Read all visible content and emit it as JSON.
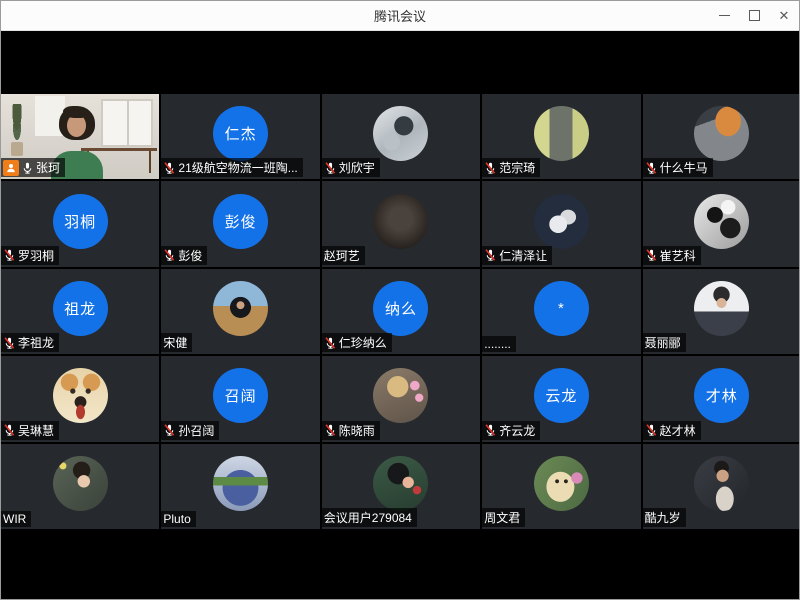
{
  "window": {
    "title": "腾讯会议",
    "controls": [
      "minimize",
      "maximize",
      "close"
    ]
  },
  "colors": {
    "accent_blue": "#1472E8",
    "tile_background": "#26292E",
    "content_background": "#000000",
    "titlebar_background": "#FCFCFC",
    "label_background": "rgba(0,0,0,0.66)",
    "muted_slash_red": "#E0352B",
    "host_badge_orange": "#EF7D1A"
  },
  "icons": {
    "mic_on": "mic-on-icon",
    "mic_muted": "mic-muted-icon",
    "person_badge": "person-badge-icon"
  },
  "participants": [
    {
      "name": "张珂",
      "avatar": "video",
      "mic": "on",
      "host_badge": true
    },
    {
      "name": "21级航空物流一班陶...",
      "avatar": "initials",
      "initials": "仁杰",
      "mic": "muted",
      "host_badge": false
    },
    {
      "name": "刘欣宇",
      "avatar": "photo",
      "photo": "astronaut",
      "mic": "muted",
      "host_badge": false
    },
    {
      "name": "范宗琦",
      "avatar": "photo",
      "photo": "book",
      "mic": "muted",
      "host_badge": false
    },
    {
      "name": "什么牛马",
      "avatar": "photo",
      "photo": "cat",
      "mic": "muted",
      "host_badge": false
    },
    {
      "name": "罗羽桐",
      "avatar": "initials",
      "initials": "羽桐",
      "mic": "muted",
      "host_badge": false
    },
    {
      "name": "彭俊",
      "avatar": "initials",
      "initials": "彭俊",
      "mic": "muted",
      "host_badge": false
    },
    {
      "name": "赵珂艺",
      "avatar": "photo",
      "photo": "darkblur",
      "mic": "none",
      "host_badge": false
    },
    {
      "name": "仁清泽让",
      "avatar": "photo",
      "photo": "sneakers",
      "mic": "muted",
      "host_badge": false
    },
    {
      "name": "崔艺科",
      "avatar": "photo",
      "photo": "bwart",
      "mic": "muted",
      "host_badge": false
    },
    {
      "name": "李祖龙",
      "avatar": "initials",
      "initials": "祖龙",
      "mic": "muted",
      "host_badge": false
    },
    {
      "name": "宋健",
      "avatar": "photo",
      "photo": "hooded",
      "mic": "none",
      "host_badge": false
    },
    {
      "name": "仁珍纳么",
      "avatar": "initials",
      "initials": "纳么",
      "mic": "muted",
      "host_badge": false
    },
    {
      "name": "........",
      "avatar": "initials",
      "initials": "*",
      "mic": "none",
      "host_badge": false
    },
    {
      "name": "聂丽郦",
      "avatar": "photo",
      "photo": "lightperson",
      "mic": "none",
      "host_badge": false
    },
    {
      "name": "吴琳慧",
      "avatar": "photo",
      "photo": "shiba",
      "mic": "muted",
      "host_badge": false
    },
    {
      "name": "孙召阔",
      "avatar": "initials",
      "initials": "召阔",
      "mic": "muted",
      "host_badge": false
    },
    {
      "name": "陈晓雨",
      "avatar": "photo",
      "photo": "blonde",
      "mic": "muted",
      "host_badge": false
    },
    {
      "name": "齐云龙",
      "avatar": "initials",
      "initials": "云龙",
      "mic": "muted",
      "host_badge": false
    },
    {
      "name": "赵才林",
      "avatar": "initials",
      "initials": "才林",
      "mic": "muted",
      "host_badge": false
    },
    {
      "name": "WIR",
      "avatar": "photo",
      "photo": "peacegirl",
      "mic": "none",
      "host_badge": false
    },
    {
      "name": "Pluto",
      "avatar": "photo",
      "photo": "stitch",
      "mic": "none",
      "host_badge": false
    },
    {
      "name": "会议用户279084",
      "avatar": "photo",
      "photo": "animegirl",
      "mic": "none",
      "host_badge": false
    },
    {
      "name": "周文君",
      "avatar": "photo",
      "photo": "puppy",
      "mic": "none",
      "host_badge": false
    },
    {
      "name": "酷九岁",
      "avatar": "photo",
      "photo": "darkperson",
      "mic": "none",
      "host_badge": false
    }
  ]
}
